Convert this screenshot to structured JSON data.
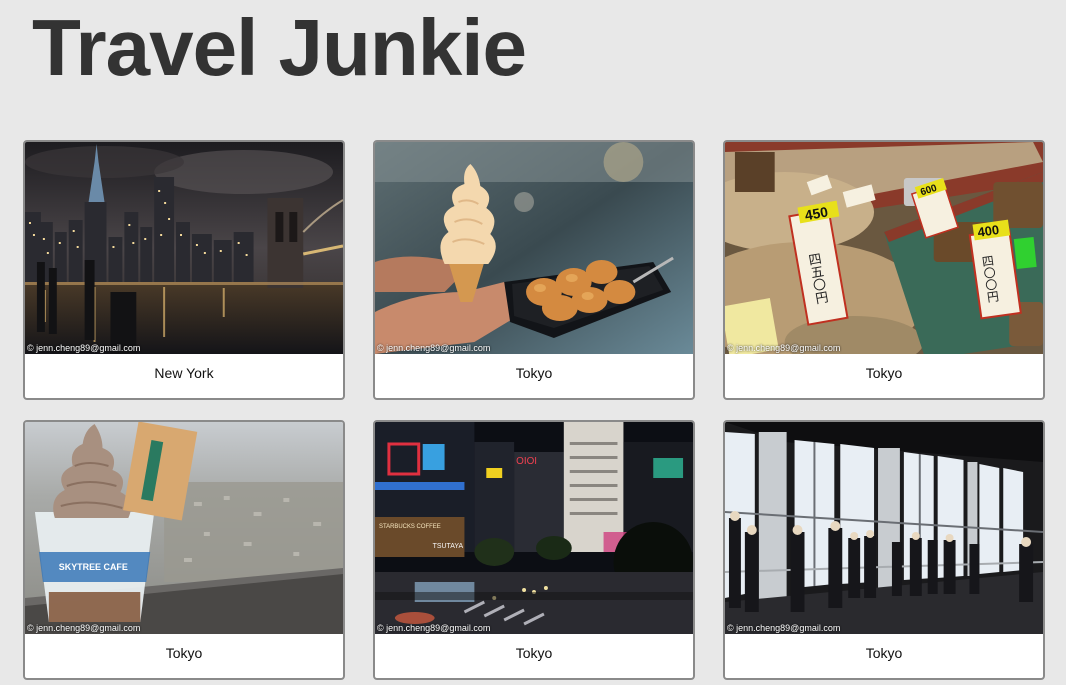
{
  "site": {
    "title": "Travel Junkie"
  },
  "gallery": {
    "credit": "© jenn.cheng89@gmail.com",
    "cards": [
      {
        "caption": "New York",
        "photo": "new-york-skyline-brooklyn-bridge-night"
      },
      {
        "caption": "Tokyo",
        "photo": "soft-serve-ice-cream-and-takoyaki"
      },
      {
        "caption": "Tokyo",
        "photo": "dried-fish-market-stall-price-tags"
      },
      {
        "caption": "Tokyo",
        "photo": "skytree-cafe-soft-serve-over-city"
      },
      {
        "caption": "Tokyo",
        "photo": "shibuya-crossing-night"
      },
      {
        "caption": "Tokyo",
        "photo": "skytree-observation-deck-visitors"
      }
    ],
    "price_tags": {
      "tag1": "450",
      "tag1_text": "四五〇円",
      "tag2": "600",
      "tag3": "400",
      "tag3_text": "四〇〇円"
    },
    "signs": {
      "cafe": "SKYTREE CAFE",
      "starbucks": "STARBUCKS COFFEE",
      "tsutaya": "TSUTAYA",
      "oioi": "OIOI"
    }
  }
}
